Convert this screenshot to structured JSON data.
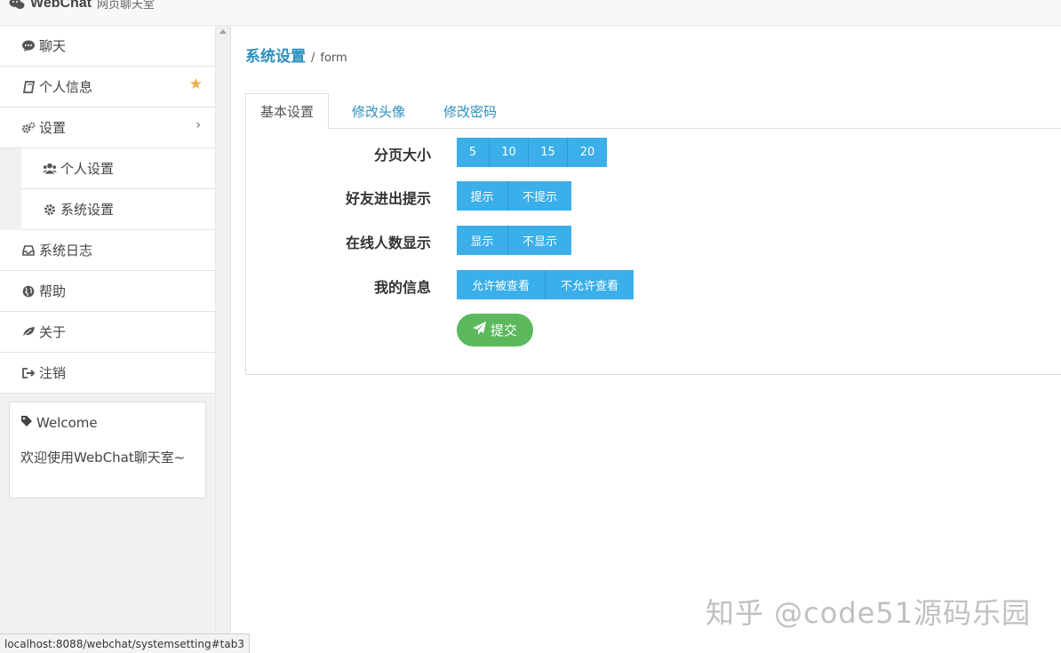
{
  "header": {
    "brand_name": "WebChat",
    "brand_sub": "网页聊天室"
  },
  "sidebar": {
    "items": [
      {
        "label": "聊天",
        "icon": "comment-icon"
      },
      {
        "label": "个人信息",
        "icon": "book-icon",
        "badge_icon": "star-icon"
      },
      {
        "label": "设置",
        "icon": "cogs-icon",
        "expand_icon": "chevron-right-icon"
      },
      {
        "label": "个人设置",
        "icon": "users-icon"
      },
      {
        "label": "系统设置",
        "icon": "cog-icon"
      },
      {
        "label": "系统日志",
        "icon": "inbox-icon"
      },
      {
        "label": "帮助",
        "icon": "globe-icon"
      },
      {
        "label": "关于",
        "icon": "leaf-icon"
      },
      {
        "label": "注销",
        "icon": "sign-out-icon"
      }
    ],
    "welcome": {
      "title": "Welcome",
      "text": "欢迎使用WebChat聊天室~"
    }
  },
  "main": {
    "breadcrumb": {
      "main": "系统设置",
      "sep": "/",
      "sub": "form"
    },
    "tabs": [
      {
        "label": "基本设置",
        "active": true
      },
      {
        "label": "修改头像",
        "active": false
      },
      {
        "label": "修改密码",
        "active": false
      }
    ],
    "form": {
      "rows": [
        {
          "label": "分页大小",
          "options": [
            "5",
            "10",
            "15",
            "20"
          ]
        },
        {
          "label": "好友进出提示",
          "options": [
            "提示",
            "不提示"
          ]
        },
        {
          "label": "在线人数显示",
          "options": [
            "显示",
            "不显示"
          ]
        },
        {
          "label": "我的信息",
          "options": [
            "允许被查看",
            "不允许查看"
          ]
        }
      ],
      "submit_label": "提交"
    }
  },
  "colors": {
    "accent": "#3aafe9",
    "link": "#2a8fbd",
    "success": "#5cb85c",
    "star": "#f0ad4e"
  },
  "watermark": "知乎 @code51源码乐园",
  "status_url": "localhost:8088/webchat/systemsetting#tab3"
}
